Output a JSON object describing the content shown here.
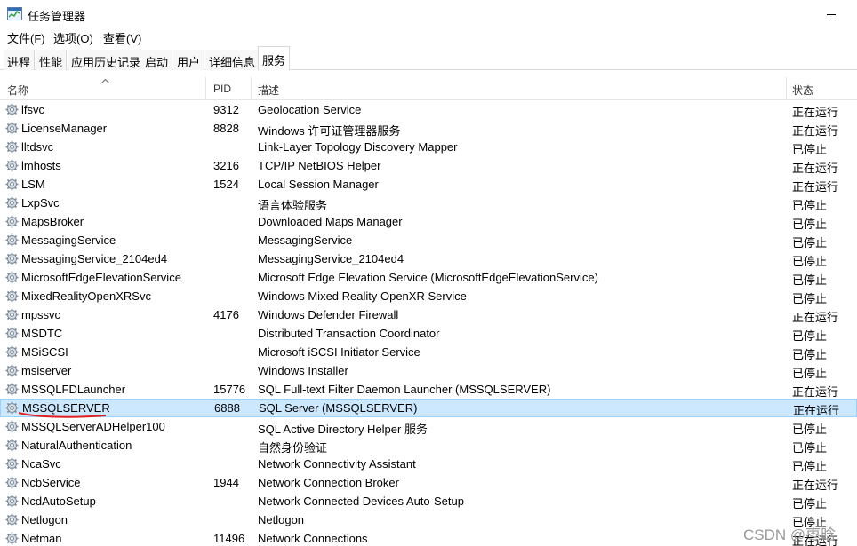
{
  "window": {
    "title": "任务管理器"
  },
  "menu": [
    "文件(F)",
    "选项(O)",
    "查看(V)"
  ],
  "tabs": [
    "进程",
    "性能",
    "应用历史记录",
    "启动",
    "用户",
    "详细信息",
    "服务"
  ],
  "active_tab": "服务",
  "columns": {
    "name": "名称",
    "pid": "PID",
    "desc": "描述",
    "status": "状态"
  },
  "icons": {
    "row_icon": "gear-icon",
    "app_icon": "task-manager-icon"
  },
  "rows": [
    {
      "name": "lfsvc",
      "pid": "9312",
      "desc": "Geolocation Service",
      "status": "正在运行"
    },
    {
      "name": "LicenseManager",
      "pid": "8828",
      "desc": "Windows 许可证管理器服务",
      "status": "正在运行"
    },
    {
      "name": "lltdsvc",
      "pid": "",
      "desc": "Link-Layer Topology Discovery Mapper",
      "status": "已停止"
    },
    {
      "name": "lmhosts",
      "pid": "3216",
      "desc": "TCP/IP NetBIOS Helper",
      "status": "正在运行"
    },
    {
      "name": "LSM",
      "pid": "1524",
      "desc": "Local Session Manager",
      "status": "正在运行"
    },
    {
      "name": "LxpSvc",
      "pid": "",
      "desc": "语言体验服务",
      "status": "已停止"
    },
    {
      "name": "MapsBroker",
      "pid": "",
      "desc": "Downloaded Maps Manager",
      "status": "已停止"
    },
    {
      "name": "MessagingService",
      "pid": "",
      "desc": "MessagingService",
      "status": "已停止"
    },
    {
      "name": "MessagingService_2104ed4",
      "pid": "",
      "desc": "MessagingService_2104ed4",
      "status": "已停止"
    },
    {
      "name": "MicrosoftEdgeElevationService",
      "pid": "",
      "desc": "Microsoft Edge Elevation Service (MicrosoftEdgeElevationService)",
      "status": "已停止"
    },
    {
      "name": "MixedRealityOpenXRSvc",
      "pid": "",
      "desc": "Windows Mixed Reality OpenXR Service",
      "status": "已停止"
    },
    {
      "name": "mpssvc",
      "pid": "4176",
      "desc": "Windows Defender Firewall",
      "status": "正在运行"
    },
    {
      "name": "MSDTC",
      "pid": "",
      "desc": "Distributed Transaction Coordinator",
      "status": "已停止"
    },
    {
      "name": "MSiSCSI",
      "pid": "",
      "desc": "Microsoft iSCSI Initiator Service",
      "status": "已停止"
    },
    {
      "name": "msiserver",
      "pid": "",
      "desc": "Windows Installer",
      "status": "已停止"
    },
    {
      "name": "MSSQLFDLauncher",
      "pid": "15776",
      "desc": "SQL Full-text Filter Daemon Launcher (MSSQLSERVER)",
      "status": "正在运行"
    },
    {
      "name": "MSSQLSERVER",
      "pid": "6888",
      "desc": "SQL Server (MSSQLSERVER)",
      "status": "正在运行",
      "selected": true
    },
    {
      "name": "MSSQLServerADHelper100",
      "pid": "",
      "desc": "SQL Active Directory Helper 服务",
      "status": "已停止"
    },
    {
      "name": "NaturalAuthentication",
      "pid": "",
      "desc": "自然身份验证",
      "status": "已停止"
    },
    {
      "name": "NcaSvc",
      "pid": "",
      "desc": "Network Connectivity Assistant",
      "status": "已停止"
    },
    {
      "name": "NcbService",
      "pid": "1944",
      "desc": "Network Connection Broker",
      "status": "正在运行"
    },
    {
      "name": "NcdAutoSetup",
      "pid": "",
      "desc": "Network Connected Devices Auto-Setup",
      "status": "已停止"
    },
    {
      "name": "Netlogon",
      "pid": "",
      "desc": "Netlogon",
      "status": "已停止"
    },
    {
      "name": "Netman",
      "pid": "11496",
      "desc": "Network Connections",
      "status": "正在运行"
    }
  ],
  "colors": {
    "selected_bg": "#cce8ff",
    "selected_border": "#99d1ff",
    "annotation": "#e02020"
  },
  "watermark": "CSDN @枣晗"
}
